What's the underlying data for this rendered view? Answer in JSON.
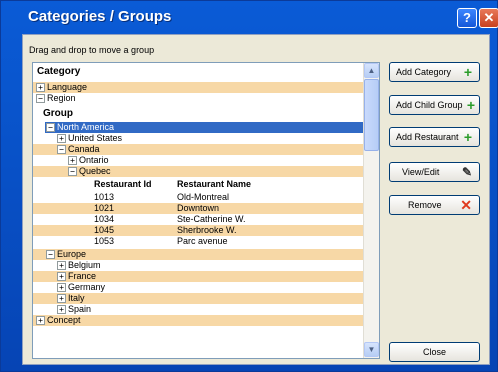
{
  "window": {
    "title": "Categories / Groups",
    "help_label": "?",
    "close_label": "✕"
  },
  "hint": "Drag and drop to move a group",
  "tree": {
    "header": "Category",
    "group_header": "Group",
    "restaurant_headers": [
      "Restaurant Id",
      "Restaurant Name"
    ],
    "rows": [
      {
        "expander": "+",
        "label": "Language"
      },
      {
        "expander": "−",
        "label": "Region"
      },
      {
        "expander": "−",
        "label": "North America"
      },
      {
        "expander": "+",
        "label": "United States"
      },
      {
        "expander": "−",
        "label": "Canada"
      },
      {
        "expander": "+",
        "label": "Ontario"
      },
      {
        "expander": "−",
        "label": "Quebec"
      },
      {
        "expander": "−",
        "label": "Europe"
      },
      {
        "expander": "+",
        "label": "Belgium"
      },
      {
        "expander": "+",
        "label": "France"
      },
      {
        "expander": "+",
        "label": "Germany"
      },
      {
        "expander": "+",
        "label": "Italy"
      },
      {
        "expander": "+",
        "label": "Spain"
      },
      {
        "expander": "+",
        "label": "Concept"
      }
    ],
    "restaurants": [
      {
        "id": "1013",
        "name": "Old-Montreal"
      },
      {
        "id": "1021",
        "name": "Downtown"
      },
      {
        "id": "1034",
        "name": "Ste-Catherine W."
      },
      {
        "id": "1045",
        "name": "Sherbrooke W."
      },
      {
        "id": "1053",
        "name": "Parc avenue"
      }
    ]
  },
  "buttons": {
    "add_category": "Add Category",
    "add_child_group": "Add Child Group",
    "add_restaurant": "Add Restaurant",
    "view_edit": "View/Edit",
    "remove": "Remove",
    "close": "Close"
  },
  "colors": {
    "title_bar": "#0a5bd6",
    "band": "#f7d8a6",
    "selection": "#316ac5",
    "plus": "#2a9c2a",
    "remove": "#e03a1e"
  }
}
